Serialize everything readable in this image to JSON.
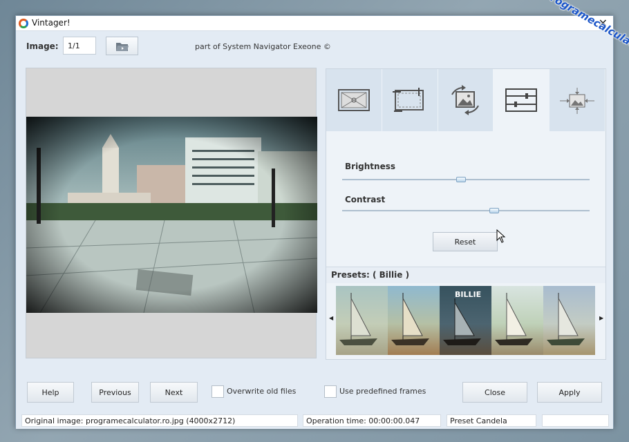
{
  "window": {
    "title": "Vintager!",
    "close_glyph": "✕"
  },
  "toolbar": {
    "image_label": "Image:",
    "image_value": "1/1",
    "credit": "part of System Navigator Exeone ©"
  },
  "tabs": [
    {
      "name": "frame",
      "icon": "frame-icon"
    },
    {
      "name": "crop",
      "icon": "crop-icon"
    },
    {
      "name": "rotate",
      "icon": "rotate-image-icon"
    },
    {
      "name": "adjust",
      "icon": "sliders-icon",
      "active": true
    },
    {
      "name": "resize",
      "icon": "resize-icon"
    }
  ],
  "adjust": {
    "brightness_label": "Brightness",
    "brightness_value": 0.48,
    "contrast_label": "Contrast",
    "contrast_value": 0.62,
    "reset_label": "Reset"
  },
  "presets": {
    "label": "Presets: ( Billie )",
    "items": [
      {
        "name": "preset-1",
        "caption": ""
      },
      {
        "name": "preset-2",
        "caption": ""
      },
      {
        "name": "preset-billie",
        "caption": "BILLIE"
      },
      {
        "name": "preset-4",
        "caption": ""
      },
      {
        "name": "preset-5",
        "caption": ""
      }
    ]
  },
  "buttons": {
    "help": "Help",
    "previous": "Previous",
    "next": "Next",
    "overwrite": "Overwrite old files",
    "predefined": "Use predefined frames",
    "close": "Close",
    "apply": "Apply"
  },
  "status": {
    "original": "Original image: programecalculator.ro.jpg (4000x2712)",
    "operation": "Operation time: 00:00:00.047",
    "preset": "Preset Candela",
    "extra": ""
  },
  "watermark": "programecalculator.ro"
}
